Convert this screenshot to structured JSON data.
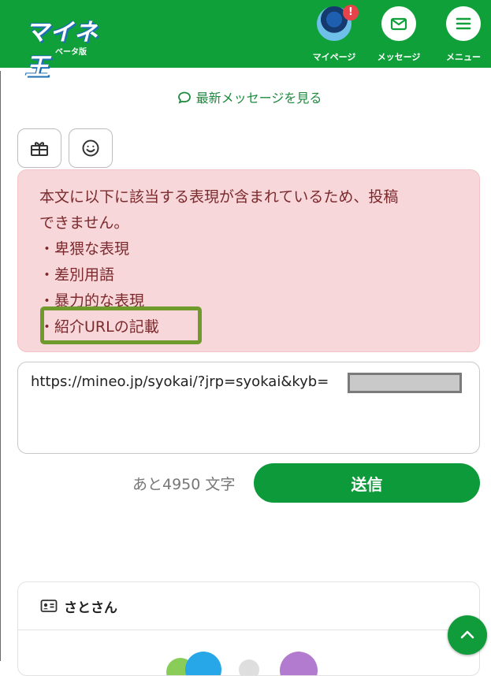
{
  "header": {
    "logo_text": "マイネ王",
    "logo_sub": "ベータ版",
    "mypage_label": "マイページ",
    "mypage_badge": "!",
    "message_label": "メッセージ",
    "menu_label": "メニュー",
    "brand_color": "#0fa03a"
  },
  "latest_link": "最新メッセージを見る",
  "toolbar": {
    "gift_icon": "gift-icon",
    "emoji_icon": "smile-icon"
  },
  "error": {
    "lines": [
      "本文に以下に該当する表現が含まれているため、投稿",
      "できません。",
      "・卑猥な表現",
      "・差別用語",
      "・暴力的な表現",
      "・紹介URLの記載"
    ]
  },
  "post": {
    "text": "https://mineo.jp/syokai/?jrp=syokai&kyb="
  },
  "counter": "あと4950 文字",
  "send_label": "送信",
  "card": {
    "user_name": "さとさん"
  }
}
